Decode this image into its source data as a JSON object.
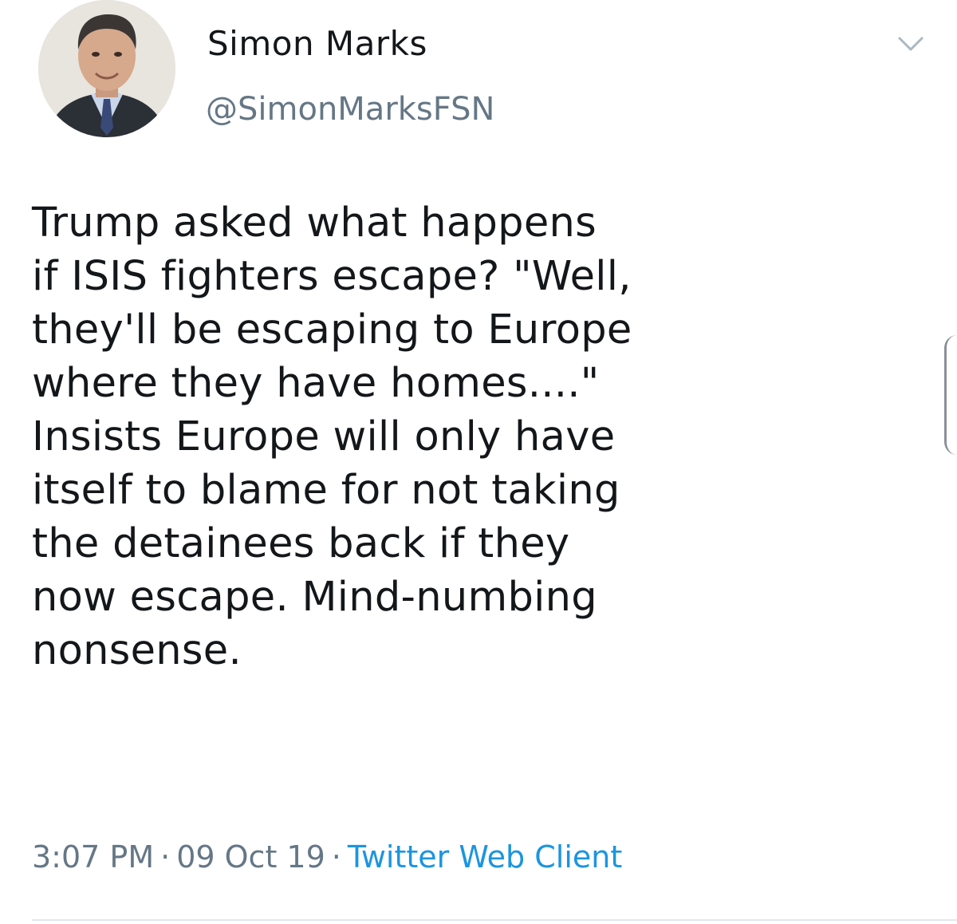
{
  "user": {
    "display_name": "Simon Marks",
    "handle": "@SimonMarksFSN"
  },
  "tweet": {
    "text": "Trump asked what happens\nif ISIS fighters escape?  \"Well,\nthey'll be escaping to Europe\nwhere they have homes....\"\nInsists Europe will only have\nitself to blame for not taking\nthe detainees back if they\nnow escape.  Mind-numbing\nnonsense."
  },
  "meta": {
    "time": "3:07 PM",
    "separator": "·",
    "date": "09 Oct 19",
    "source": "Twitter Web Client"
  },
  "icons": {
    "menu": "chevron-down-icon",
    "avatar": "profile-photo"
  },
  "colors": {
    "text": "#14171a",
    "secondary": "#657786",
    "link": "#1b95e0"
  }
}
